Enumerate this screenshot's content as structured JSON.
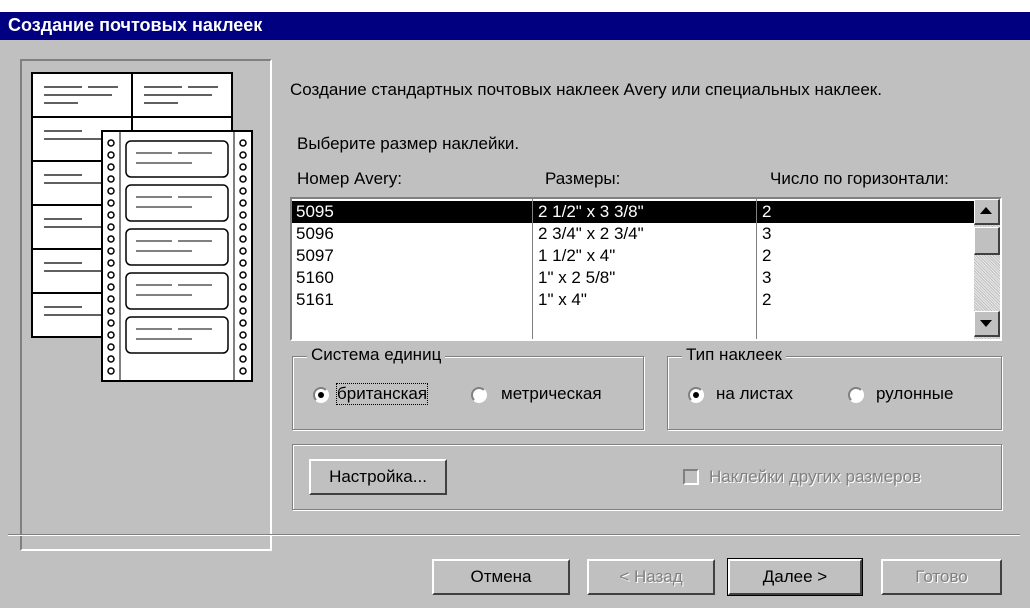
{
  "window": {
    "title": "Создание почтовых наклеек"
  },
  "intro": "Создание стандартных почтовых наклеек Avery или специальных наклеек.",
  "prompt": "Выберите размер наклейки.",
  "list": {
    "columns": [
      "Номер Avery:",
      "Размеры:",
      "Число по горизонтали:"
    ],
    "rows": [
      {
        "number": "5095",
        "size": "2 1/2\" x 3 3/8\"",
        "across": "2"
      },
      {
        "number": "5096",
        "size": "2 3/4\" x 2 3/4\"",
        "across": "3"
      },
      {
        "number": "5097",
        "size": "1 1/2\" x 4\"",
        "across": "2"
      },
      {
        "number": "5160",
        "size": "1\" x 2 5/8\"",
        "across": "3"
      },
      {
        "number": "5161",
        "size": "1\" x 4\"",
        "across": "2"
      }
    ],
    "selected_index": 0
  },
  "units": {
    "label": "Система единиц",
    "options": [
      "британская",
      "метрическая"
    ],
    "selected": "британская"
  },
  "label_type": {
    "label": "Тип наклеек",
    "options": [
      "на листах",
      "рулонные"
    ],
    "selected": "на листах"
  },
  "customize_button": "Настройка...",
  "custom_sizes_checkbox": {
    "label": "Наклейки других размеров",
    "checked": false,
    "enabled": false
  },
  "buttons": {
    "cancel": "Отмена",
    "back": "< Назад",
    "next": "Далее >",
    "finish": "Готово"
  }
}
